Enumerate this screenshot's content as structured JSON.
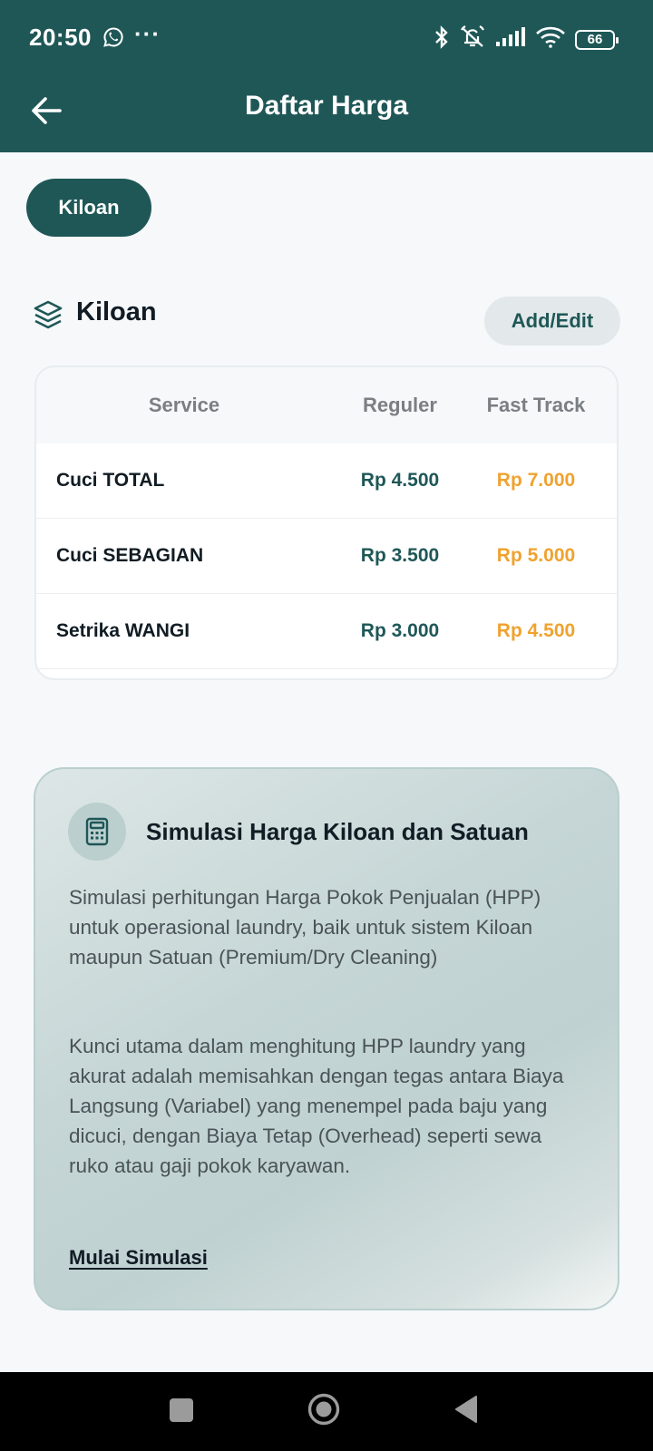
{
  "status_bar": {
    "time": "20:50",
    "more": "···",
    "battery": "66",
    "icons": [
      "whatsapp-icon",
      "bluetooth-icon",
      "silent-icon",
      "signal-icon",
      "wifi-icon",
      "battery-icon"
    ]
  },
  "app_bar": {
    "title": "Daftar Harga",
    "back_icon": "arrow-left-icon"
  },
  "filter_chip": {
    "label": "Kiloan"
  },
  "section": {
    "title": "Kiloan",
    "icon": "layers-icon",
    "action_label": "Add/Edit"
  },
  "price_table": {
    "headers": {
      "service": "Service",
      "reguler": "Reguler",
      "fast_track": "Fast Track"
    },
    "rows": [
      {
        "service": "Cuci TOTAL",
        "reguler": "Rp 4.500",
        "fast_track": "Rp 7.000"
      },
      {
        "service": "Cuci SEBAGIAN",
        "reguler": "Rp 3.500",
        "fast_track": "Rp 5.000"
      },
      {
        "service": "Setrika WANGI",
        "reguler": "Rp 3.000",
        "fast_track": "Rp 4.500"
      }
    ]
  },
  "simulation": {
    "icon": "calculator-icon",
    "title": "Simulasi Harga Kiloan dan Satuan",
    "paragraph_1": "Simulasi perhitungan Harga Pokok Penjualan (HPP) untuk operasional laundry, baik untuk sistem Kiloan maupun Satuan (Premium/Dry Cleaning)",
    "paragraph_2": "Kunci utama dalam menghitung HPP laundry yang akurat adalah memisahkan dengan tegas antara Biaya Langsung (Variabel) yang menempel pada baju yang dicuci, dengan Biaya Tetap (Overhead) seperti sewa ruko atau gaji pokok karyawan.",
    "link_label": "Mulai Simulasi"
  },
  "colors": {
    "primary": "#1f5757",
    "accent": "#f0a22e",
    "background": "#f6f8fa"
  }
}
